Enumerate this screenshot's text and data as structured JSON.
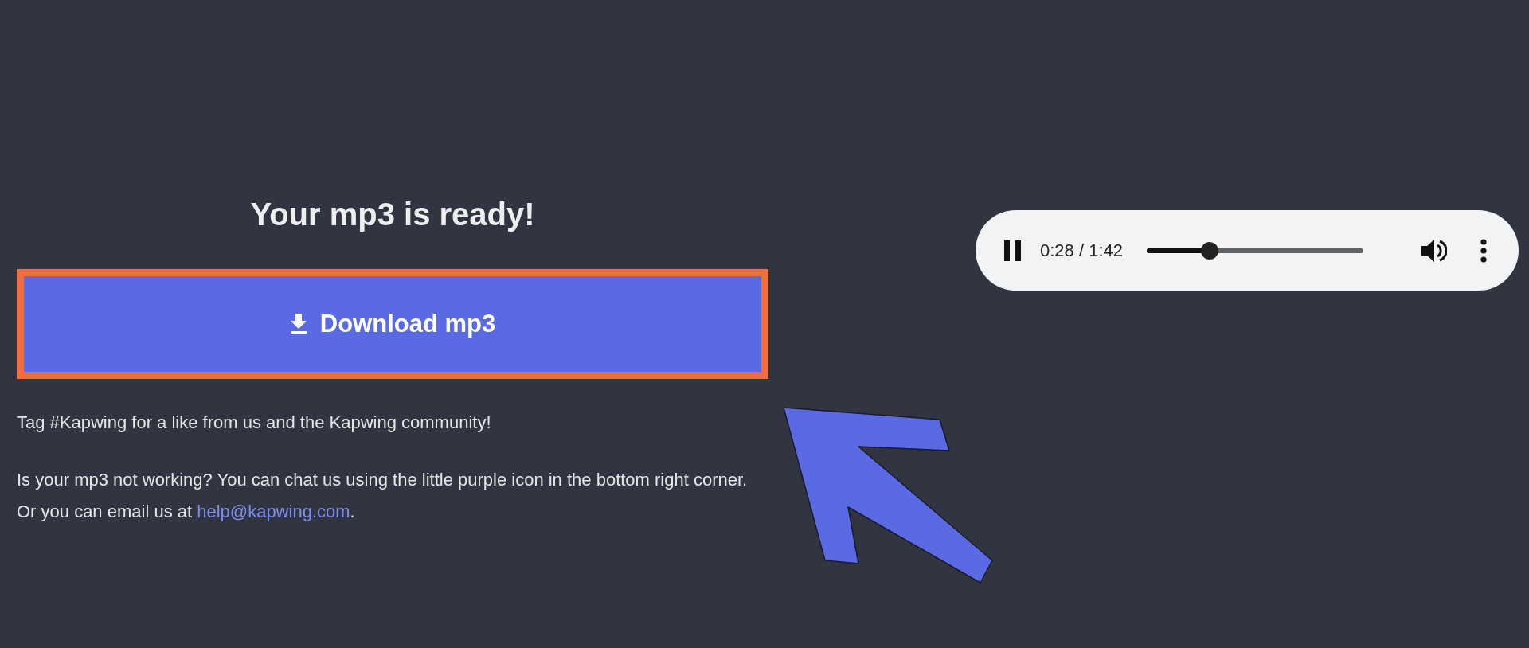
{
  "title": "Your mp3 is ready!",
  "download_button": {
    "label": "Download mp3"
  },
  "tag_note": "Tag #Kapwing for a like from us and the Kapwing community!",
  "help": {
    "text": "Is your mp3 not working? You can chat us using the little purple icon in the bottom right corner. Or you can email us at ",
    "link": "help@kapwing.com",
    "text_after": "."
  },
  "player": {
    "playing": true,
    "time": "0:28 / 1:42",
    "level": 0.29
  }
}
